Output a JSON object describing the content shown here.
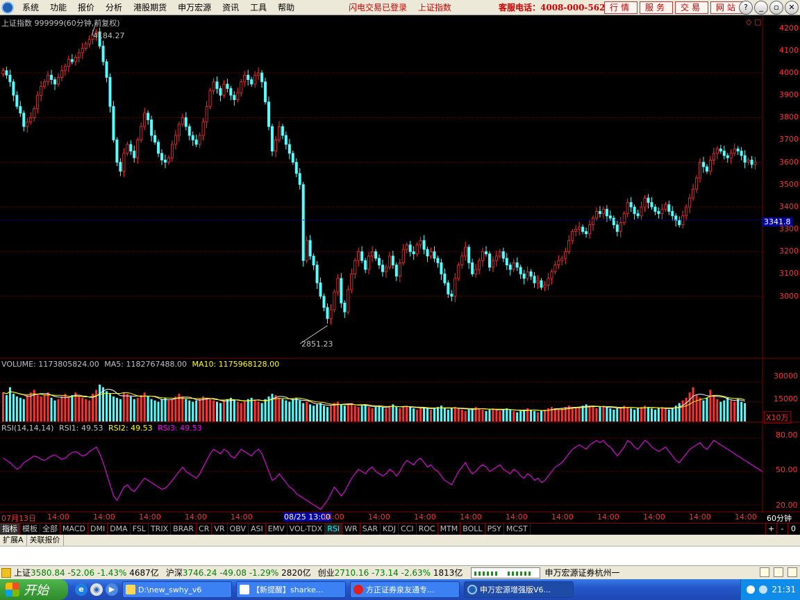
{
  "menubar": {
    "items": [
      "系统",
      "功能",
      "报价",
      "分析",
      "港股期货",
      "申万宏源",
      "资讯",
      "工具",
      "帮助"
    ],
    "flash_status": "闪电交易已登录",
    "current_index": "上证指数",
    "hotline": "客服电话：4008-000-562",
    "quick_buttons": [
      "行情",
      "服务",
      "交易",
      "网站"
    ],
    "window_buttons": [
      "?",
      "_",
      "▫",
      "✕"
    ]
  },
  "chart": {
    "title": "上证指数 999999(60分钟,前复权)",
    "max_label": "4184.27",
    "min_label": "2851.23",
    "current_price_tag": "3341.8",
    "corner_icons": [
      "◇",
      "▢"
    ],
    "price_axis_ticks": [
      "4200",
      "4100",
      "4000",
      "3900",
      "3800",
      "3700",
      "3600",
      "3500",
      "3400",
      "3300",
      "3200",
      "3100",
      "3000"
    ],
    "volume_header": {
      "volume": "VOLUME: 1173805824.00",
      "ma5": "MA5: 1182767488.00",
      "ma10": "MA10: 1175968128.00"
    },
    "volume_axis_ticks": [
      "30000",
      "15000"
    ],
    "volume_unit": "X10万",
    "rsi_header": {
      "name": "RSI(14,14,14)",
      "rsi1": "RSI1: 49.53",
      "rsi2": "RSI2: 49.53",
      "rsi3": "RSI3: 49.53"
    },
    "rsi_axis_ticks": [
      "80.00",
      "50.00",
      "20.00"
    ],
    "time_axis": [
      "07月13日",
      "14:00",
      "14:00",
      "14:00",
      "14:00",
      "14:00",
      "08/25 13:00",
      "14:00",
      "14:00",
      "14:00",
      "14:00",
      "14:00",
      "14:00",
      "14:00",
      "14:00",
      "14:00",
      "14:00",
      "14:00"
    ],
    "period_label": "60分钟"
  },
  "colors": {
    "up": "#ff3232",
    "down": "#54ffff",
    "ma5": "#ffffff",
    "ma10": "#ffff00",
    "rsi": "#ff00ff",
    "grid": "#800000"
  },
  "tabs": [
    "指标",
    "模板",
    "全部",
    "MACD",
    "DMI",
    "DMA",
    "FSL",
    "TRIX",
    "BRAR",
    "CR",
    "VR",
    "OBV",
    "ASI",
    "EMV",
    "VOL-TDX",
    "RSI",
    "WR",
    "SAR",
    "KDJ",
    "CCI",
    "ROC",
    "MTM",
    "BOLL",
    "PSY",
    "MCST"
  ],
  "tab_nav": [
    "+",
    "-",
    "0"
  ],
  "subtabs": [
    "扩展A",
    "关联报价"
  ],
  "statusbar": {
    "sh_name": "上证",
    "sh_value": "3580.84",
    "sh_change": "-52.06",
    "sh_pct": "-1.43%",
    "sh_amount": "4687亿",
    "hs_name": "沪深",
    "hs_value": "3746.24",
    "hs_change": "-49.08",
    "hs_pct": "-1.29%",
    "hs_amount": "2820亿",
    "cy_name": "创业",
    "cy_value": "2710.16",
    "cy_change": "-73.14",
    "cy_pct": "-2.63%",
    "cy_amount": "1813亿",
    "broker": "申万宏源证券杭州一"
  },
  "taskbar": {
    "start": "开始",
    "tasks": [
      "D:\\new_swhy_v6",
      "【新提醒】sharke...",
      "方正证券泉友通专...",
      "申万宏源增强版V6..."
    ],
    "clock": "21:31"
  },
  "chart_data": {
    "type": "candlestick",
    "price_ylim": [
      2800,
      4230
    ],
    "closes": [
      4010,
      3990,
      3960,
      3900,
      3850,
      3820,
      3760,
      3780,
      3800,
      3840,
      3900,
      3940,
      3960,
      3990,
      3970,
      3950,
      3980,
      4010,
      4030,
      4060,
      4050,
      4070,
      4090,
      4110,
      4130,
      4150,
      4170,
      4184,
      4120,
      4050,
      3980,
      3850,
      3700,
      3600,
      3560,
      3640,
      3680,
      3650,
      3620,
      3700,
      3760,
      3820,
      3790,
      3720,
      3690,
      3640,
      3610,
      3600,
      3620,
      3680,
      3720,
      3770,
      3800,
      3760,
      3720,
      3700,
      3680,
      3720,
      3780,
      3850,
      3920,
      3960,
      3930,
      3900,
      3950,
      3930,
      3900,
      3880,
      3910,
      3960,
      3990,
      3970,
      3950,
      3990,
      4000,
      3960,
      3870,
      3760,
      3650,
      3700,
      3760,
      3720,
      3680,
      3640,
      3600,
      3550,
      3500,
      3160,
      3250,
      3180,
      3140,
      3060,
      3000,
      2950,
      2900,
      2940,
      3020,
      3080,
      2970,
      2930,
      3030,
      3100,
      3160,
      3200,
      3160,
      3120,
      3180,
      3200,
      3170,
      3140,
      3110,
      3130,
      3180,
      3140,
      3090,
      3150,
      3210,
      3230,
      3200,
      3190,
      3230,
      3250,
      3210,
      3180,
      3200,
      3170,
      3150,
      3100,
      3060,
      3010,
      3000,
      3080,
      3140,
      3180,
      3220,
      3150,
      3100,
      3120,
      3160,
      3200,
      3190,
      3130,
      3160,
      3180,
      3200,
      3170,
      3140,
      3120,
      3150,
      3130,
      3100,
      3080,
      3110,
      3090,
      3060,
      3070,
      3040,
      3050,
      3080,
      3110,
      3140,
      3160,
      3170,
      3200,
      3250,
      3290,
      3300,
      3310,
      3290,
      3280,
      3320,
      3350,
      3380,
      3370,
      3390,
      3360,
      3350,
      3320,
      3290,
      3330,
      3370,
      3420,
      3400,
      3370,
      3360,
      3400,
      3440,
      3420,
      3400,
      3380,
      3370,
      3390,
      3410,
      3380,
      3360,
      3340,
      3320,
      3360,
      3400,
      3440,
      3480,
      3530,
      3600,
      3580,
      3560,
      3610,
      3640,
      3660,
      3650,
      3630,
      3620,
      3640,
      3660,
      3650,
      3630,
      3600,
      3610,
      3590,
      3600
    ],
    "volume_ylim": [
      0,
      40000
    ],
    "volume": [
      22000,
      20000,
      26000,
      21000,
      19000,
      18000,
      17000,
      20000,
      22000,
      24000,
      21000,
      19000,
      20000,
      22000,
      18000,
      16000,
      17000,
      19000,
      21000,
      18000,
      20000,
      22000,
      19000,
      18000,
      17000,
      16000,
      21000,
      24000,
      28000,
      26000,
      23000,
      21000,
      19000,
      18000,
      17000,
      22000,
      21000,
      19000,
      17000,
      18000,
      20000,
      22000,
      19000,
      17000,
      16000,
      15000,
      17000,
      18000,
      16000,
      17000,
      19000,
      21000,
      19000,
      17000,
      16000,
      15000,
      16000,
      17000,
      19000,
      18000,
      17000,
      16000,
      15000,
      14000,
      16000,
      17000,
      18000,
      16000,
      15000,
      14000,
      16000,
      17000,
      18000,
      16000,
      15000,
      14000,
      17000,
      19000,
      21000,
      20000,
      18000,
      17000,
      16000,
      15000,
      17000,
      18000,
      16000,
      14000,
      15000,
      13000,
      12000,
      13000,
      14000,
      12000,
      11000,
      12000,
      14000,
      15000,
      13000,
      12000,
      13000,
      14000,
      12000,
      11000,
      12000,
      13000,
      11000,
      10000,
      11000,
      12000,
      11000,
      10000,
      12000,
      13000,
      11000,
      10000,
      11000,
      12000,
      11000,
      10000,
      9000,
      10000,
      11000,
      10000,
      9000,
      10000,
      11000,
      12000,
      10000,
      9000,
      10000,
      11000,
      10000,
      9000,
      8000,
      9000,
      10000,
      11000,
      10000,
      9000,
      8000,
      9000,
      10000,
      9000,
      8000,
      9000,
      10000,
      9000,
      8000,
      7000,
      8000,
      9000,
      10000,
      9000,
      8000,
      7000,
      8000,
      9000,
      10000,
      11000,
      10000,
      9000,
      10000,
      11000,
      12000,
      11000,
      10000,
      11000,
      12000,
      13000,
      12000,
      11000,
      10000,
      11000,
      12000,
      11000,
      10000,
      9000,
      10000,
      11000,
      12000,
      11000,
      10000,
      9000,
      10000,
      11000,
      12000,
      11000,
      10000,
      9000,
      10000,
      11000,
      10000,
      9000,
      10000,
      12000,
      14000,
      16000,
      18000,
      22000,
      26000,
      20000,
      18000,
      16000,
      18000,
      24000,
      20000,
      17000,
      15000,
      16000,
      18000,
      16000,
      15000,
      17000,
      15000,
      14000
    ],
    "rsi_ylim": [
      15,
      90
    ],
    "rsi": [
      62,
      60,
      58,
      55,
      52,
      54,
      58,
      60,
      62,
      64,
      63,
      61,
      60,
      62,
      64,
      65,
      63,
      61,
      62,
      65,
      67,
      68,
      66,
      64,
      65,
      68,
      70,
      72,
      66,
      58,
      48,
      38,
      28,
      24,
      30,
      36,
      38,
      34,
      32,
      36,
      40,
      44,
      42,
      40,
      38,
      36,
      34,
      35,
      38,
      42,
      46,
      50,
      54,
      50,
      48,
      46,
      44,
      48,
      54,
      60,
      66,
      70,
      68,
      66,
      70,
      68,
      64,
      62,
      66,
      70,
      68,
      66,
      64,
      68,
      70,
      66,
      58,
      50,
      42,
      44,
      48,
      44,
      40,
      36,
      34,
      30,
      28,
      26,
      24,
      22,
      20,
      18,
      16,
      20,
      24,
      30,
      36,
      32,
      28,
      32,
      38,
      44,
      48,
      52,
      50,
      48,
      52,
      54,
      50,
      48,
      46,
      48,
      52,
      50,
      46,
      50,
      56,
      60,
      58,
      56,
      60,
      62,
      58,
      54,
      56,
      52,
      50,
      46,
      42,
      40,
      38,
      44,
      50,
      54,
      58,
      52,
      48,
      50,
      54,
      56,
      54,
      50,
      52,
      54,
      56,
      52,
      50,
      48,
      52,
      50,
      46,
      44,
      48,
      46,
      42,
      44,
      40,
      42,
      46,
      50,
      54,
      56,
      58,
      62,
      66,
      70,
      72,
      74,
      72,
      70,
      74,
      76,
      78,
      76,
      78,
      74,
      72,
      68,
      64,
      68,
      72,
      78,
      76,
      72,
      70,
      74,
      78,
      76,
      72,
      70,
      68,
      70,
      72,
      68,
      64,
      60,
      58,
      62,
      66,
      70,
      72,
      74,
      76,
      72,
      70,
      74,
      78,
      76,
      74,
      72,
      70,
      68,
      66,
      64,
      62,
      60,
      58,
      56,
      54,
      52,
      50
    ]
  }
}
